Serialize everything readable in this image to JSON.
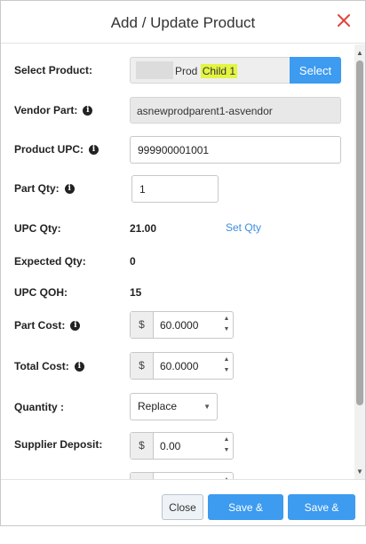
{
  "dialog": {
    "title": "Add / Update Product"
  },
  "fields": {
    "select_product": {
      "label": "Select Product:",
      "value_prefix": "Prod",
      "value_highlight": "Child 1",
      "button_label": "Select"
    },
    "vendor_part": {
      "label": "Vendor Part:",
      "value": "asnewprodparent1-asvendor"
    },
    "product_upc": {
      "label": "Product UPC:",
      "value": "999900001001"
    },
    "part_qty": {
      "label": "Part Qty:",
      "value": "1"
    },
    "upc_qty": {
      "label": "UPC Qty:",
      "value": "21.00",
      "link_label": "Set Qty"
    },
    "expected_qty": {
      "label": "Expected Qty:",
      "value": "0"
    },
    "upc_qoh": {
      "label": "UPC QOH:",
      "value": "15"
    },
    "part_cost": {
      "label": "Part Cost:",
      "currency": "$",
      "value": "60.0000"
    },
    "total_cost": {
      "label": "Total Cost:",
      "currency": "$",
      "value": "60.0000"
    },
    "quantity": {
      "label": "Quantity :",
      "selected": "Replace"
    },
    "supplier_deposit": {
      "label": "Supplier Deposit:",
      "currency": "$",
      "value": "0.00"
    },
    "partial_row": {
      "currency": "$"
    }
  },
  "footer": {
    "close_label": "Close",
    "save_close_label": "Save & Close",
    "save_add_label": "Save & Add"
  },
  "icons": {
    "close": "close-icon",
    "info": "info-icon",
    "spin_up": "spin-up-icon",
    "spin_down": "spin-down-icon"
  },
  "colors": {
    "primary": "#3d9bf0",
    "close_x": "#e0433a",
    "highlight": "#e3f542",
    "link": "#3d8fe0"
  }
}
